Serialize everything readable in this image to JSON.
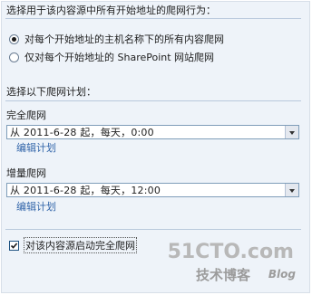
{
  "scope": {
    "title": "选择用于该内容源中所有开始地址的爬网行为：",
    "options": [
      {
        "label": "对每个开始地址的主机名称下的所有内容爬网",
        "checked": true
      },
      {
        "label": "仅对每个开始地址的 SharePoint 网站爬网",
        "checked": false
      }
    ]
  },
  "schedule": {
    "title": "选择以下爬网计划：",
    "full": {
      "label": "完全爬网",
      "selected": "从 2011-6-28 起，每天，0:00",
      "edit_link": "编辑计划"
    },
    "incremental": {
      "label": "增量爬网",
      "selected": "从 2011-6-28 起，每天，12:00",
      "edit_link": "编辑计划"
    }
  },
  "start_full_crawl": {
    "label": "对该内容源启动完全爬网",
    "checked": true
  },
  "watermark": {
    "main": "51CTO.com",
    "sub": "技术博客",
    "blog": "Blog"
  },
  "colors": {
    "panel": "#eef3f9",
    "link": "#3366aa",
    "select_border": "#7f9db9"
  }
}
